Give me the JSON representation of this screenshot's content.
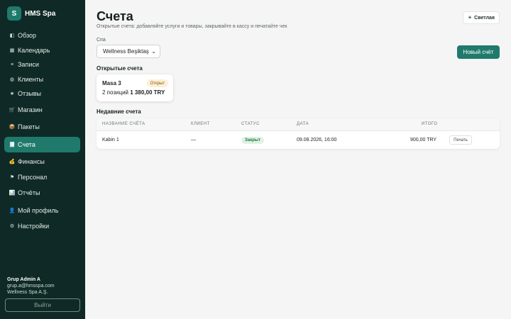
{
  "brand": {
    "logo_letter": "S",
    "name": "HMS Spa"
  },
  "sidebar": {
    "items": [
      {
        "icon": "◧",
        "icon_name": "overview-icon",
        "label": "Обзор"
      },
      {
        "icon": "▦",
        "icon_name": "calendar-icon",
        "label": "Календарь"
      },
      {
        "icon": "≡",
        "icon_name": "list-icon",
        "label": "Записи"
      },
      {
        "icon": "◍",
        "icon_name": "clients-icon",
        "label": "Клиенты"
      },
      {
        "icon": "★",
        "icon_name": "star-icon",
        "label": "Отзывы"
      },
      {
        "icon": "🛒",
        "icon_name": "cart-icon",
        "label": "Магазин"
      },
      {
        "icon": "📦",
        "icon_name": "package-icon",
        "label": "Пакеты"
      },
      {
        "icon": "🧾",
        "icon_name": "receipt-icon",
        "label": "Счета"
      },
      {
        "icon": "💰",
        "icon_name": "money-bag-icon",
        "label": "Финансы"
      },
      {
        "icon": "⚑",
        "icon_name": "flag-icon",
        "label": "Персонал"
      },
      {
        "icon": "📊",
        "icon_name": "chart-icon",
        "label": "Отчёты"
      },
      {
        "icon": "👤",
        "icon_name": "user-icon",
        "label": "Мой профиль"
      },
      {
        "icon": "⚙",
        "icon_name": "gear-icon",
        "label": "Настройки"
      }
    ],
    "active_index": 7
  },
  "user": {
    "name": "Grup Admin A",
    "email": "grup.a@hmsspa.com",
    "company": "Wellness Spa A.Ş."
  },
  "logout_label": "Выйти",
  "header": {
    "title": "Счета",
    "subtitle": "Открытые счета: добавляйте услуги и товары, закрывайте в кассу и печатайте чек",
    "theme_label": "Светлая",
    "theme_icon": "☀"
  },
  "spa": {
    "label": "Спа",
    "selected": "Wellness Beşiktaş"
  },
  "new_bill_label": "Новый счёт",
  "open_bills": {
    "title": "Открытые счета",
    "items": [
      {
        "name": "Masa 3",
        "status": "Открыт",
        "positions": "2 позиций",
        "total": "1 380,00 TRY"
      }
    ]
  },
  "recent_bills": {
    "title": "Недавние счета",
    "columns": [
      "Название счёта",
      "Клиент",
      "Статус",
      "Дата",
      "Итого"
    ],
    "rows": [
      {
        "name": "Kabin 1",
        "client": "—",
        "status": "Закрыт",
        "date": "09.08.2026, 16:00",
        "total": "900,00 TRY",
        "action": "Печать"
      }
    ]
  },
  "colors": {
    "sidebar_bg": "#0f2a26",
    "accent": "#1f7a6c",
    "open_badge_bg": "#fcefd5",
    "closed_badge_bg": "#e0f2e5"
  }
}
